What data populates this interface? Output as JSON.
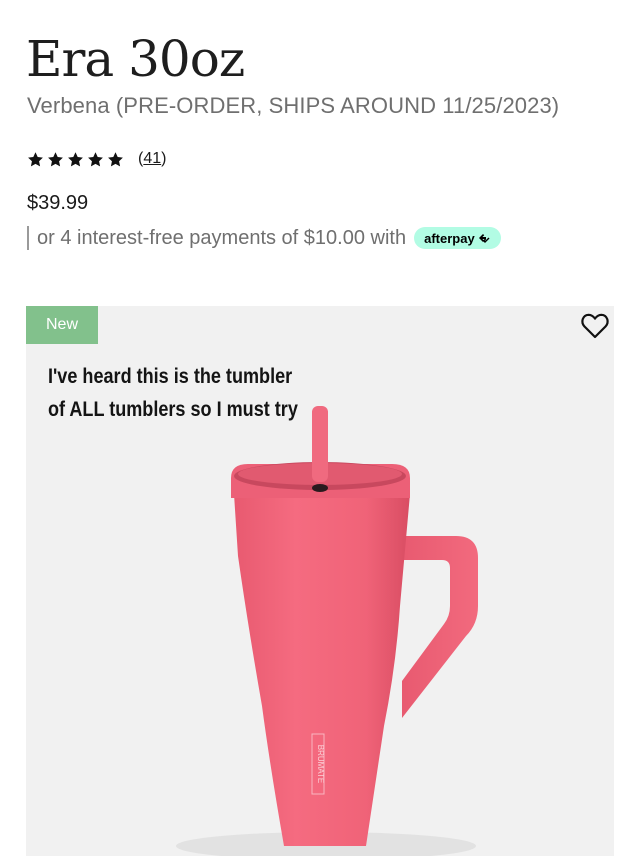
{
  "product": {
    "title": "Era 30oz",
    "variant": "Verbena (PRE-ORDER, SHIPS AROUND 11/25/2023)",
    "rating": {
      "stars": 5,
      "max": 5,
      "review_count": "41",
      "open": "(",
      "close": ")"
    },
    "price": "$39.99",
    "installment": {
      "text": "or 4 interest-free payments of $10.00 with",
      "provider": "afterpay"
    }
  },
  "media": {
    "badge": "New",
    "caption_line1": "I've heard this is the tumbler",
    "caption_line2": "of ALL tumblers so I must try",
    "tumbler_brand_text": "BRUMATE",
    "colors": {
      "tumbler": "#f2647a",
      "badge": "#82c18c",
      "afterpay": "#b2fce4"
    }
  },
  "icons": {
    "wishlist": "heart-outline-icon",
    "rating": "star-icon",
    "afterpay": "afterpay-arrows-icon"
  }
}
